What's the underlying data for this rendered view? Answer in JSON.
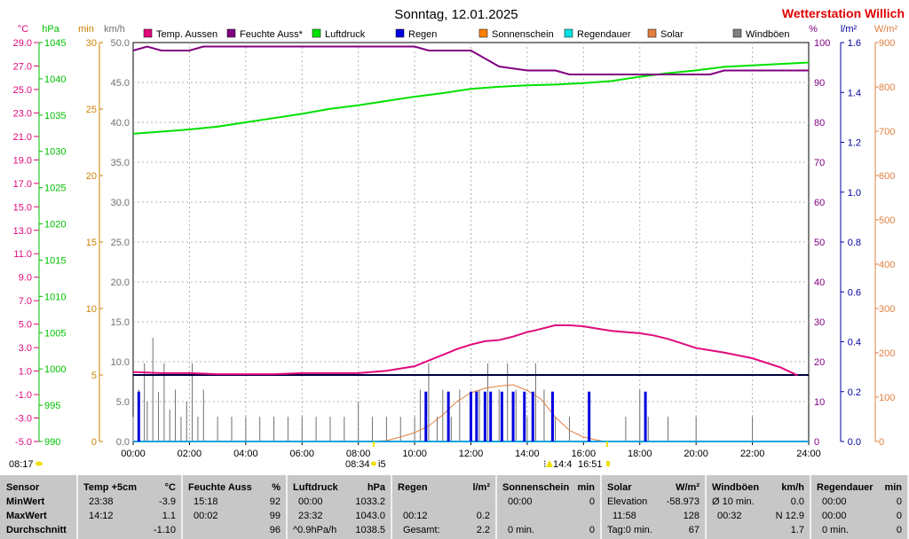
{
  "header": {
    "title": "Sonntag, 12.01.2025",
    "station": "Wetterstation Willich"
  },
  "legend": [
    {
      "label": "Temp. Aussen",
      "color": "#e0087c"
    },
    {
      "label": "Feuchte Auss*",
      "color": "#800080"
    },
    {
      "label": "Luftdruck",
      "color": "#00e000"
    },
    {
      "label": "Regen",
      "color": "#0000e0"
    },
    {
      "label": "Sonnenschein",
      "color": "#ff8000"
    },
    {
      "label": "Regendauer",
      "color": "#00e0e0"
    },
    {
      "label": "Solar",
      "color": "#e08040"
    },
    {
      "label": "Windböen",
      "color": "#808080"
    }
  ],
  "axes": {
    "temp": {
      "unit": "°C",
      "color": "#e0087c",
      "ticks": [
        "29.0",
        "27.0",
        "25.0",
        "23.0",
        "21.0",
        "19.0",
        "17.0",
        "15.0",
        "13.0",
        "11.0",
        "9.0",
        "7.0",
        "5.0",
        "3.0",
        "1.0",
        "-1.0",
        "-3.0",
        "-5.0"
      ]
    },
    "pressure": {
      "unit": "hPa",
      "color": "#00c000",
      "ticks": [
        "1045",
        "1040",
        "1035",
        "1030",
        "1025",
        "1020",
        "1015",
        "1010",
        "1005",
        "1000",
        "995",
        "990"
      ]
    },
    "minutes": {
      "unit": "min",
      "color": "#d08000",
      "ticks": [
        "30",
        "25",
        "20",
        "15",
        "10",
        "5",
        "0"
      ]
    },
    "wind": {
      "unit": "km/h",
      "color": "#707070",
      "ticks": [
        "50.0",
        "45.0",
        "40.0",
        "35.0",
        "30.0",
        "25.0",
        "20.0",
        "15.0",
        "10.0",
        "5.0",
        "0.0"
      ]
    },
    "humidity": {
      "unit": "%",
      "color": "#800080",
      "ticks": [
        "100",
        "90",
        "80",
        "70",
        "60",
        "50",
        "40",
        "30",
        "20",
        "10",
        "0"
      ]
    },
    "rain": {
      "unit": "l/m²",
      "color": "#0000a0",
      "ticks": [
        "1.6",
        "1.4",
        "1.2",
        "1.0",
        "0.8",
        "0.6",
        "0.4",
        "0.2",
        "0.0"
      ]
    },
    "solar": {
      "unit": "W/m²",
      "color": "#e08040",
      "ticks": [
        "900",
        "800",
        "700",
        "600",
        "500",
        "400",
        "300",
        "200",
        "100",
        "0"
      ]
    },
    "time": {
      "ticks": [
        "00:00",
        "02:00",
        "04:00",
        "06:00",
        "08:00",
        "10:00",
        "12:00",
        "14:00",
        "16:00",
        "18:00",
        "20:00",
        "22:00",
        "24:00"
      ]
    }
  },
  "annotations": {
    "sunrise": "08:17",
    "sun_start": "08:34",
    "sun_start_suffix": "i5",
    "solar_peak": "14:4",
    "sun_end": "16:51"
  },
  "chart_data": {
    "type": "line",
    "x_unit": "hour of day",
    "xlim": [
      0,
      24
    ],
    "series": [
      {
        "name": "Temp. Aussen",
        "axis": "°C",
        "ylim": [
          -5,
          30
        ],
        "x": [
          0,
          1,
          2,
          3,
          4,
          5,
          6,
          7,
          8,
          9,
          10,
          10.5,
          11,
          11.5,
          12,
          12.5,
          13,
          13.5,
          14,
          14.2,
          15,
          15.5,
          16,
          16.5,
          17,
          17.5,
          18,
          18.5,
          19,
          20,
          21,
          22,
          23,
          23.6
        ],
        "y": [
          1.1,
          1.0,
          1.0,
          0.9,
          0.9,
          0.9,
          1.0,
          1.0,
          1.0,
          1.2,
          1.6,
          2.1,
          2.6,
          3.1,
          3.5,
          3.8,
          3.9,
          4.2,
          4.6,
          4.7,
          5.2,
          5.2,
          5.1,
          4.9,
          4.7,
          4.6,
          4.5,
          4.3,
          4.0,
          3.2,
          2.8,
          2.3,
          1.5,
          0.8
        ]
      },
      {
        "name": "Feuchte Auss*",
        "axis": "%",
        "ylim": [
          0,
          100
        ],
        "x": [
          0,
          0.5,
          1,
          2,
          2.5,
          3,
          4,
          5,
          6,
          7,
          8,
          9,
          10,
          10.5,
          11,
          12,
          12.5,
          13,
          14,
          15,
          15.5,
          16,
          17,
          18,
          19,
          20,
          20.5,
          21,
          22,
          23,
          24
        ],
        "y": [
          98,
          99,
          98,
          98,
          99,
          99,
          99,
          99,
          99,
          99,
          99,
          99,
          99,
          98,
          98,
          98,
          96,
          94,
          93,
          93,
          92,
          92,
          92,
          92,
          92,
          92,
          92,
          93,
          93,
          93,
          93
        ]
      },
      {
        "name": "Luftdruck",
        "axis": "hPa",
        "ylim": [
          990,
          1046
        ],
        "x": [
          0,
          1,
          2,
          3,
          4,
          5,
          6,
          7,
          8,
          9,
          10,
          11,
          12,
          13,
          14,
          15,
          16,
          17,
          18,
          19,
          20,
          21,
          22,
          23,
          24
        ],
        "y": [
          1033.2,
          1033.5,
          1033.8,
          1034.2,
          1034.8,
          1035.4,
          1036.0,
          1036.7,
          1037.2,
          1037.8,
          1038.4,
          1038.9,
          1039.5,
          1039.8,
          1040.0,
          1040.1,
          1040.3,
          1040.6,
          1041.2,
          1041.7,
          1042.1,
          1042.6,
          1042.8,
          1043.0,
          1043.2
        ]
      },
      {
        "name": "Regen",
        "axis": "l/m²",
        "ylim": [
          0,
          1.6
        ],
        "x": [
          0.2,
          10.4,
          11.2,
          12.0,
          12.2,
          12.5,
          12.7,
          13.1,
          13.5,
          13.9,
          14.2,
          14.9,
          16.2,
          18.2
        ],
        "y": [
          0.2,
          0.2,
          0.2,
          0.2,
          0.2,
          0.2,
          0.2,
          0.2,
          0.2,
          0.2,
          0.2,
          0.2,
          0.2,
          0.2
        ]
      },
      {
        "name": "Solar",
        "axis": "W/m²",
        "ylim": [
          0,
          900
        ],
        "x": [
          8.3,
          9,
          9.5,
          10,
          10.5,
          11,
          11.5,
          12,
          12.5,
          13,
          13.5,
          14,
          14.5,
          15,
          15.5,
          16,
          16.5,
          16.8
        ],
        "y": [
          0,
          2,
          10,
          20,
          35,
          60,
          90,
          110,
          120,
          125,
          128,
          115,
          95,
          55,
          25,
          10,
          3,
          0
        ]
      },
      {
        "name": "Windböen",
        "axis": "km/h",
        "ylim": [
          0,
          50
        ],
        "x": [
          0,
          0.2,
          0.4,
          0.5,
          0.7,
          0.9,
          1.1,
          1.3,
          1.5,
          1.7,
          1.9,
          2.1,
          2.3,
          2.5,
          3,
          3.5,
          4,
          4.5,
          5,
          5.5,
          6,
          6.5,
          7,
          7.5,
          8,
          8.5,
          9,
          9.5,
          10,
          10.2,
          10.5,
          10.8,
          11,
          11.3,
          11.6,
          12,
          12.3,
          12.6,
          13,
          13.3,
          13.6,
          14,
          14.3,
          14.6,
          15,
          15.5,
          16,
          17,
          17.5,
          18,
          18.3,
          19,
          20,
          20.5,
          21,
          22,
          22.5,
          23,
          24
        ],
        "y": [
          3.1,
          6.5,
          9.8,
          5.0,
          13.0,
          6.2,
          9.8,
          4.0,
          6.5,
          3.1,
          5.0,
          9.8,
          3.1,
          6.5,
          3.1,
          3.1,
          3.1,
          3.1,
          3.1,
          3.1,
          3.1,
          3.1,
          3.1,
          3.1,
          5.0,
          3.1,
          3.1,
          3.1,
          3.1,
          6.5,
          9.8,
          3.1,
          6.5,
          3.1,
          6.5,
          3.1,
          6.5,
          9.8,
          6.5,
          9.8,
          6.5,
          3.1,
          9.8,
          6.5,
          3.1,
          3.1,
          0,
          0,
          3.1,
          6.5,
          3.1,
          3.1,
          3.1,
          0,
          0,
          3.1,
          0,
          0,
          0
        ]
      },
      {
        "name": "Regendauer",
        "axis": "min",
        "ylim": [
          0,
          30
        ],
        "x": [
          0,
          24
        ],
        "y": [
          0,
          0
        ]
      }
    ]
  },
  "stats": [
    {
      "header": [
        "Sensor",
        ""
      ],
      "rows": [
        [
          "MinWert",
          ""
        ],
        [
          "MaxWert",
          ""
        ],
        [
          "Durchschnitt",
          ""
        ]
      ]
    },
    {
      "header": [
        "Temp +5cm",
        "°C"
      ],
      "rows": [
        [
          "23:38",
          "-3.9"
        ],
        [
          "14:12",
          "1.1"
        ],
        [
          "",
          "-1.10"
        ]
      ]
    },
    {
      "header": [
        "Feuchte Auss",
        "%"
      ],
      "rows": [
        [
          "15:18",
          "92"
        ],
        [
          "00:02",
          "99"
        ],
        [
          "",
          "96"
        ]
      ]
    },
    {
      "header": [
        "Luftdruck",
        "hPa"
      ],
      "rows": [
        [
          "00:00",
          "1033.2"
        ],
        [
          "23:32",
          "1043.0"
        ],
        [
          "^0.9hPa/h",
          "1038.5"
        ]
      ]
    },
    {
      "header": [
        "Regen",
        "l/m²"
      ],
      "rows": [
        [
          "",
          ""
        ],
        [
          "00:12",
          "0.2"
        ],
        [
          "Gesamt:",
          "2.2"
        ]
      ]
    },
    {
      "header": [
        "Sonnenschein",
        "min"
      ],
      "rows": [
        [
          "00:00",
          "0"
        ],
        [
          "",
          ""
        ],
        [
          "0 min.",
          "0"
        ]
      ]
    },
    {
      "header": [
        "Solar",
        "W/m²"
      ],
      "rows": [
        [
          "Elevation",
          "-58.973"
        ],
        [
          "11:58",
          "128"
        ],
        [
          "Tag:0 min.",
          "67"
        ]
      ]
    },
    {
      "header": [
        "Windböen",
        "km/h"
      ],
      "rows": [
        [
          "Ø 10 min.",
          "0.0"
        ],
        [
          "00:32",
          "N 12.9"
        ],
        [
          "",
          "1.7"
        ]
      ]
    },
    {
      "header": [
        "Regendauer",
        "min"
      ],
      "rows": [
        [
          "00:00",
          "0"
        ],
        [
          "00:00",
          "0"
        ],
        [
          "0 min.",
          "0"
        ]
      ]
    }
  ]
}
